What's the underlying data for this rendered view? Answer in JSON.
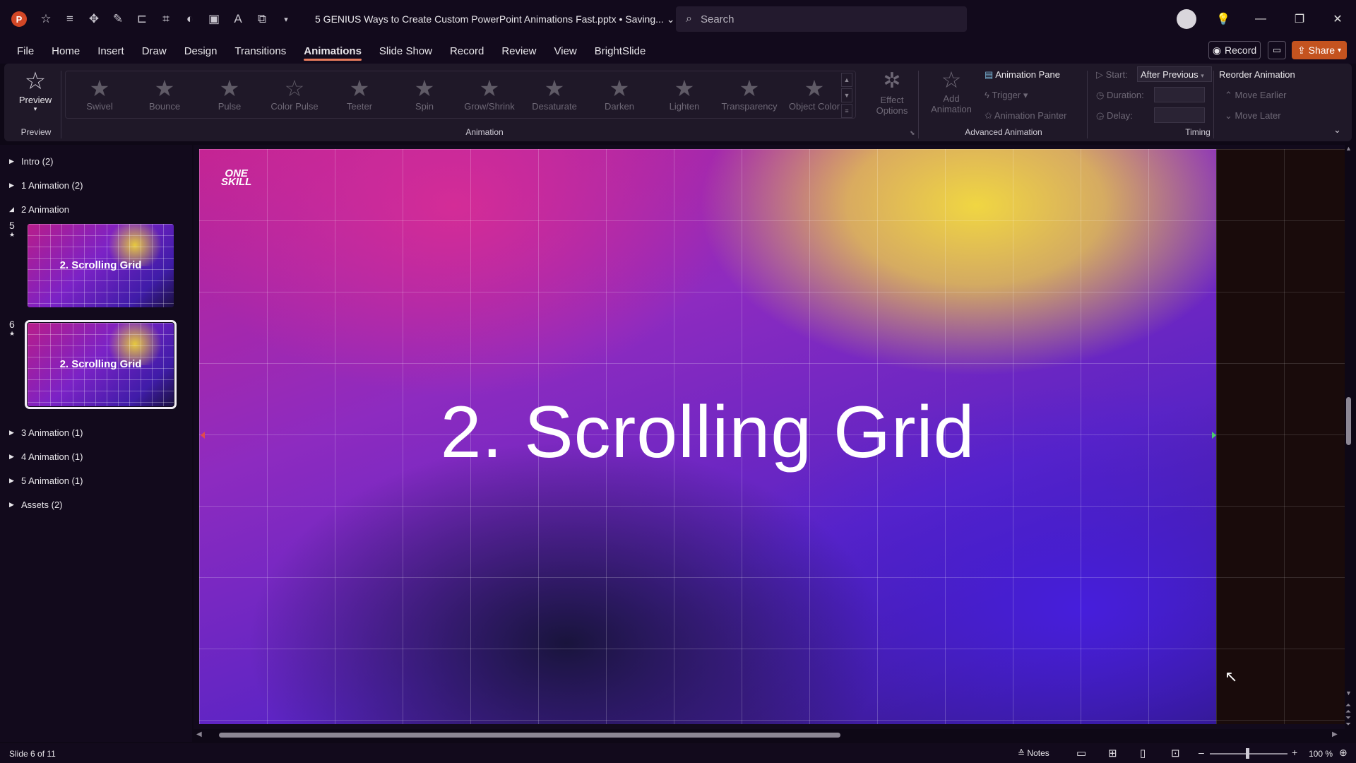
{
  "titlebar": {
    "app_icon": "P",
    "document_title": "5 GENIUS Ways to Create Custom PowerPoint Animations Fast.pptx • Saving...",
    "search_placeholder": "Search"
  },
  "menu_tabs": [
    "File",
    "Home",
    "Insert",
    "Draw",
    "Design",
    "Transitions",
    "Animations",
    "Slide Show",
    "Record",
    "Review",
    "View",
    "BrightSlide"
  ],
  "active_tab": "Animations",
  "header_buttons": {
    "record": "Record",
    "share": "Share"
  },
  "ribbon": {
    "preview": {
      "label": "Preview",
      "group_label": "Preview"
    },
    "animation_group_label": "Animation",
    "animations": [
      "Swivel",
      "Bounce",
      "Pulse",
      "Color Pulse",
      "Teeter",
      "Spin",
      "Grow/Shrink",
      "Desaturate",
      "Darken",
      "Lighten",
      "Transparency",
      "Object Color"
    ],
    "effect_options": [
      "Effect",
      "Options"
    ],
    "add_animation": [
      "Add",
      "Animation"
    ],
    "advanced": {
      "animation_pane": "Animation Pane",
      "trigger": "Trigger",
      "animation_painter": "Animation Painter",
      "group_label": "Advanced Animation"
    },
    "timing": {
      "start_label": "Start:",
      "start_value": "After Previous",
      "duration_label": "Duration:",
      "delay_label": "Delay:",
      "group_label": "Timing"
    },
    "reorder": {
      "title": "Reorder Animation",
      "move_earlier": "Move Earlier",
      "move_later": "Move Later"
    }
  },
  "slide_pane": {
    "sections": [
      {
        "label": "Intro (2)",
        "expanded": false
      },
      {
        "label": "1 Animation (2)",
        "expanded": false
      },
      {
        "label": "2 Animation",
        "expanded": true
      },
      {
        "label": "3 Animation (1)",
        "expanded": false
      },
      {
        "label": "4 Animation (1)",
        "expanded": false
      },
      {
        "label": "5 Animation (1)",
        "expanded": false
      },
      {
        "label": "Assets (2)",
        "expanded": false
      }
    ],
    "slides": [
      {
        "number": "5",
        "title": "2. Scrolling Grid",
        "selected": false
      },
      {
        "number": "6",
        "title": "2. Scrolling Grid",
        "selected": true
      }
    ]
  },
  "slide": {
    "logo": [
      "ONE",
      "SKILL"
    ],
    "title": "2. Scrolling Grid"
  },
  "statusbar": {
    "slide_info": "Slide 6 of 11",
    "notes": "Notes",
    "zoom": "100 %"
  },
  "colors": {
    "accent": "#c4531f",
    "tab_underline": "#e57a5c",
    "slide_magenta": "#c42493",
    "slide_yellow": "#f0d642",
    "slide_violet": "#5b24c4"
  }
}
